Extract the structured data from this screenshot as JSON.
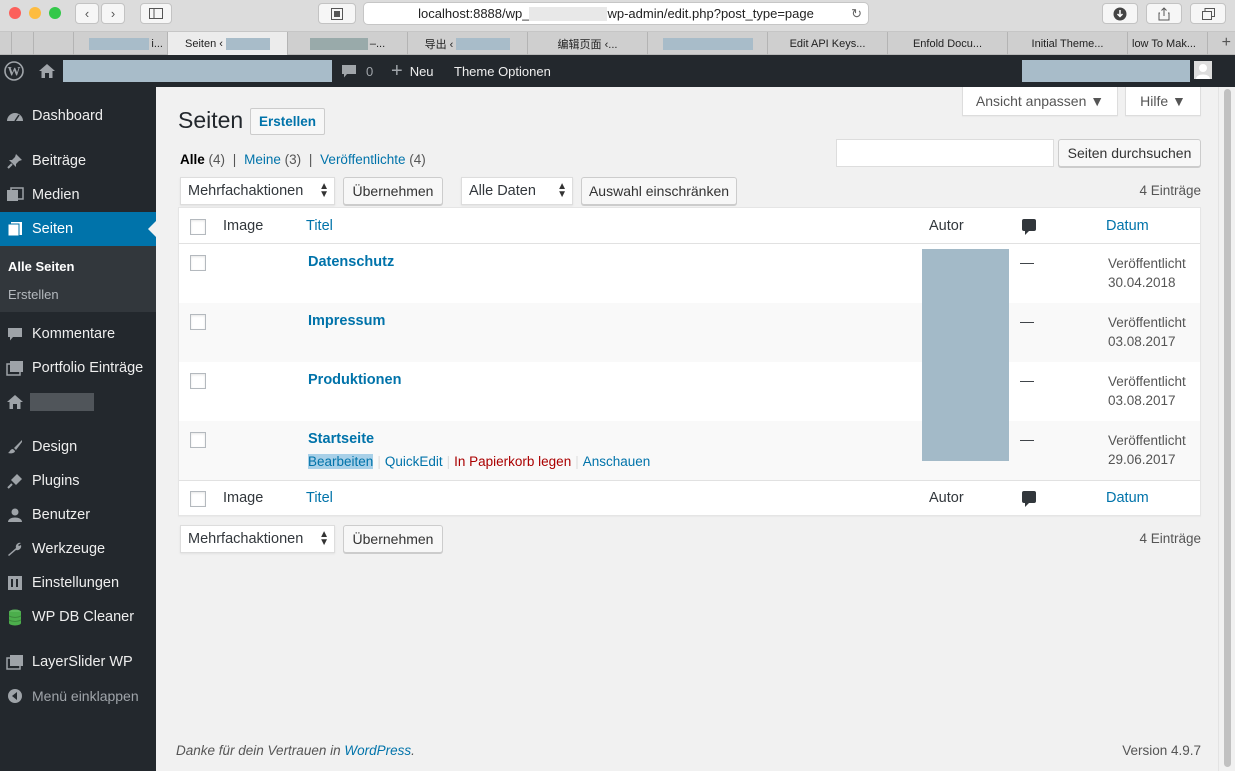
{
  "browser": {
    "url_prefix": "localhost:8888/wp_",
    "url_suffix": "wp-admin/edit.php?post_type=page",
    "tabs": [
      {
        "label": "i..."
      },
      {
        "label": "Seiten ‹"
      },
      {
        "label": "–..."
      },
      {
        "label": "导出 ‹"
      },
      {
        "label": "编辑页面 ‹..."
      },
      {
        "label": ""
      },
      {
        "label": "Edit API Keys..."
      },
      {
        "label": "Enfold Docu..."
      },
      {
        "label": "Initial Theme..."
      },
      {
        "label": "low To Mak..."
      }
    ]
  },
  "adminbar": {
    "comment_count": "0",
    "new_label": "Neu",
    "theme_options_label": "Theme Optionen"
  },
  "sidebar": {
    "items": [
      {
        "label": "Dashboard",
        "icon": "dashboard-icon"
      },
      {
        "label": "Beiträge",
        "icon": "pin-icon"
      },
      {
        "label": "Medien",
        "icon": "media-icon"
      },
      {
        "label": "Seiten",
        "icon": "pages-icon"
      },
      {
        "label": "Kommentare",
        "icon": "comment-icon"
      },
      {
        "label": "Portfolio Einträge",
        "icon": "portfolio-icon"
      },
      {
        "label": "",
        "icon": "home-icon"
      },
      {
        "label": "Design",
        "icon": "brush-icon"
      },
      {
        "label": "Plugins",
        "icon": "plugin-icon"
      },
      {
        "label": "Benutzer",
        "icon": "user-icon"
      },
      {
        "label": "Werkzeuge",
        "icon": "wrench-icon"
      },
      {
        "label": "Einstellungen",
        "icon": "settings-icon"
      },
      {
        "label": "WP DB Cleaner",
        "icon": "database-icon"
      },
      {
        "label": "LayerSlider WP",
        "icon": "layers-icon"
      },
      {
        "label": "Menü einklappen",
        "icon": "collapse-icon"
      }
    ],
    "submenu": [
      {
        "label": "Alle Seiten"
      },
      {
        "label": "Erstellen"
      }
    ]
  },
  "screen_options": {
    "view_label": "Ansicht anpassen ▼",
    "help_label": "Hilfe ▼"
  },
  "header": {
    "title": "Seiten",
    "add_new": "Erstellen"
  },
  "filters": {
    "all": "Alle",
    "all_count": "(4)",
    "mine": "Meine",
    "mine_count": "(3)",
    "published": "Veröffentlichte",
    "published_count": "(4)",
    "sep": "|"
  },
  "search": {
    "placeholder": "",
    "button": "Seiten durchsuchen"
  },
  "toolbar": {
    "bulk_actions": "Mehrfachaktionen",
    "apply": "Übernehmen",
    "dates": "Alle Daten",
    "filter": "Auswahl einschränken",
    "count": "4 Einträge"
  },
  "table": {
    "columns": {
      "image": "Image",
      "title": "Titel",
      "author": "Autor",
      "date": "Datum"
    },
    "rows": [
      {
        "title": "Datenschutz",
        "comments": "—",
        "status": "Veröffentlicht",
        "date": "30.04.2018"
      },
      {
        "title": "Impressum",
        "comments": "—",
        "status": "Veröffentlicht",
        "date": "03.08.2017"
      },
      {
        "title": "Produktionen",
        "comments": "—",
        "status": "Veröffentlicht",
        "date": "03.08.2017"
      },
      {
        "title": "Startseite",
        "comments": "—",
        "status": "Veröffentlicht",
        "date": "29.06.2017"
      }
    ],
    "row_actions": {
      "edit": "Bearbeiten",
      "quickedit": "QuickEdit",
      "trash": "In Papierkorb legen",
      "view": "Anschauen"
    }
  },
  "footer": {
    "thanks": "Danke für dein Vertrauen in",
    "wp_link": "WordPress",
    "period": ".",
    "version": "Version 4.9.7"
  },
  "colors": {
    "accent": "#0073aa",
    "adminbar": "#23282d",
    "trash": "#aa0000"
  }
}
